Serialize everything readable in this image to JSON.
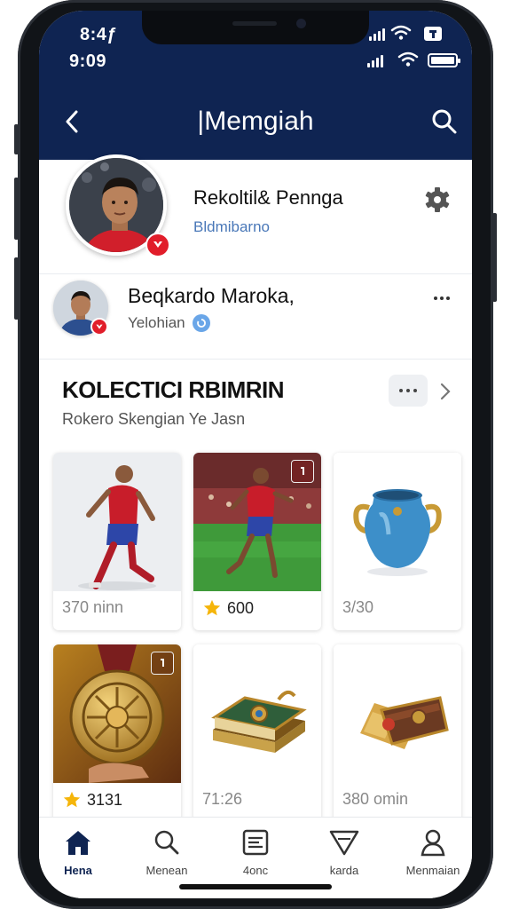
{
  "status": {
    "time_top": "8:4ƒ",
    "time_main": "9:09"
  },
  "header": {
    "title": "|Memgiah"
  },
  "profile": {
    "name": "Rekoltil& Pennga",
    "subtitle": "Bldmibarno"
  },
  "user": {
    "name": "Beqkardo Maroka,",
    "subtitle": "Yelohian"
  },
  "collection": {
    "title": "KOLECTICI RBIMRIN",
    "subtitle": "Rokero Skengian Ye Jasn",
    "items": [
      {
        "value": "370 ninn"
      },
      {
        "value": "600"
      },
      {
        "value": "3/30"
      },
      {
        "value": "3131"
      },
      {
        "value": "71:26"
      },
      {
        "value": "380 omin"
      }
    ]
  },
  "nav": {
    "items": [
      {
        "label": "Hena"
      },
      {
        "label": "Menean"
      },
      {
        "label": "4onc"
      },
      {
        "label": "karda"
      },
      {
        "label": "Menmaian"
      }
    ]
  },
  "colors": {
    "header_bg": "#0f2452",
    "badge_red": "#e11d2a",
    "star": "#f5b50a",
    "link_blue": "#4a78b8"
  },
  "icons": [
    "back-arrow-icon",
    "search-icon",
    "gear-icon",
    "more-icon",
    "chevron-right-icon",
    "star-icon",
    "home-icon",
    "profile-icon"
  ]
}
